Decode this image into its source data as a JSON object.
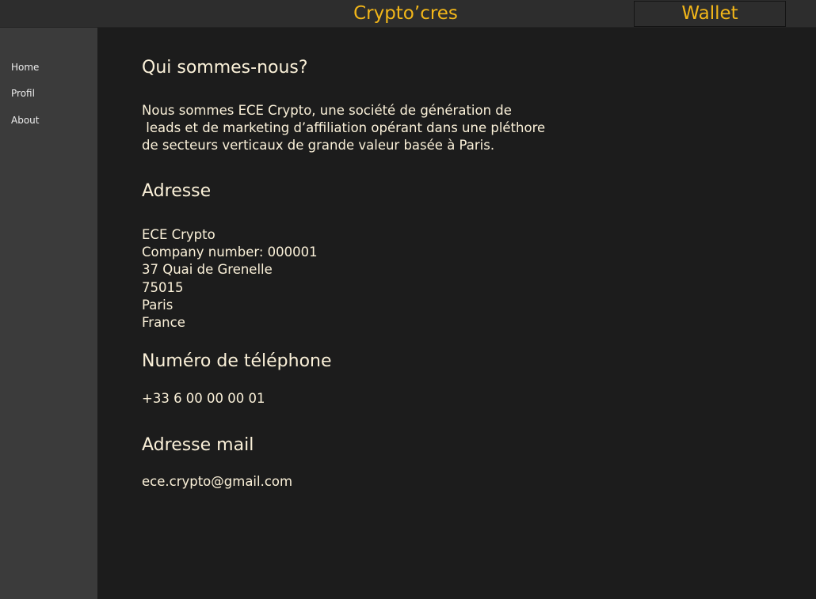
{
  "header": {
    "brand": "Crypto’cres",
    "wallet_label": "Wallet"
  },
  "sidebar": {
    "items": [
      {
        "label": "Home"
      },
      {
        "label": "Profil"
      },
      {
        "label": "About"
      }
    ]
  },
  "about": {
    "heading": "Qui sommes-nous?",
    "lines": [
      "Nous sommes ECE Crypto, une société de génération de",
      " leads et de marketing d’affiliation opérant dans une pléthore",
      "de secteurs verticaux de grande valeur basée à Paris."
    ]
  },
  "address": {
    "heading": "Adresse",
    "lines": [
      "ECE Crypto",
      "Company number: 000001",
      "37 Quai de Grenelle",
      "75015",
      "Paris",
      "France"
    ]
  },
  "phone": {
    "heading": "Numéro de téléphone",
    "value": "+33 6 00 00 00 01"
  },
  "email": {
    "heading": "Adresse mail",
    "value": "ece.crypto@gmail.com"
  },
  "colors": {
    "accent": "#f2b619",
    "text": "#fbf1d9",
    "topbar_bg": "#2d2d2d",
    "sidebar_bg": "#3b3b3b",
    "main_bg": "#1c1c1c"
  }
}
